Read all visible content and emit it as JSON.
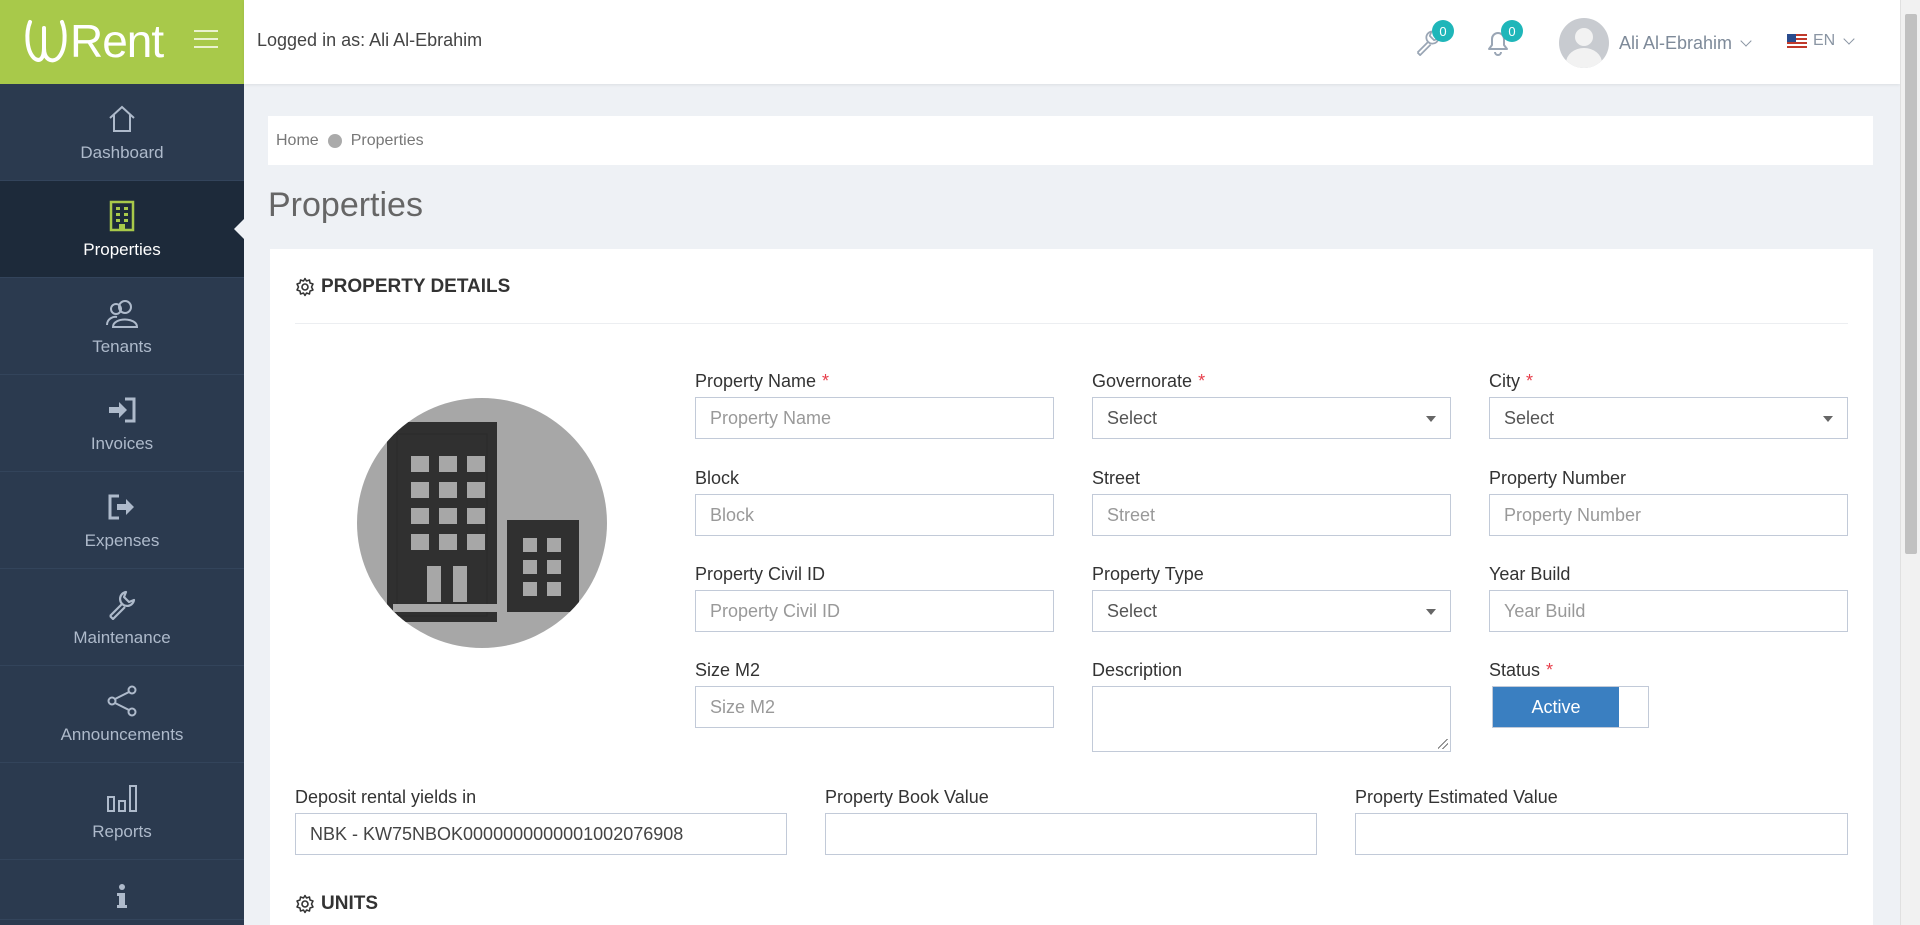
{
  "app": {
    "logo_text": "Rent"
  },
  "sidebar": {
    "items": [
      {
        "label": "Dashboard",
        "icon": "home-icon"
      },
      {
        "label": "Properties",
        "icon": "building-icon"
      },
      {
        "label": "Tenants",
        "icon": "users-icon"
      },
      {
        "label": "Invoices",
        "icon": "sign-in-icon"
      },
      {
        "label": "Expenses",
        "icon": "sign-out-icon"
      },
      {
        "label": "Maintenance",
        "icon": "wrench-icon"
      },
      {
        "label": "Announcements",
        "icon": "share-icon"
      },
      {
        "label": "Reports",
        "icon": "bar-chart-icon"
      },
      {
        "label": "",
        "icon": "info-icon"
      }
    ],
    "active": "Properties"
  },
  "topbar": {
    "logged_in_text": "Logged in as: Ali Al-Ebrahim",
    "maintenance_badge": "0",
    "notifications_badge": "0",
    "user_name": "Ali Al-Ebrahim",
    "language": "EN"
  },
  "breadcrumb": {
    "home": "Home",
    "current": "Properties"
  },
  "page_title": "Properties",
  "property_details": {
    "title": "PROPERTY DETAILS",
    "fields": {
      "property_name": {
        "label": "Property Name",
        "placeholder": "Property Name",
        "required": "*"
      },
      "governorate": {
        "label": "Governorate",
        "value": "Select",
        "required": "*"
      },
      "city": {
        "label": "City",
        "value": "Select",
        "required": "*"
      },
      "block": {
        "label": "Block",
        "placeholder": "Block"
      },
      "street": {
        "label": "Street",
        "placeholder": "Street"
      },
      "property_number": {
        "label": "Property Number",
        "placeholder": "Property Number"
      },
      "civil_id": {
        "label": "Property Civil ID",
        "placeholder": "Property Civil ID"
      },
      "property_type": {
        "label": "Property Type",
        "value": "Select"
      },
      "year_build": {
        "label": "Year Build",
        "placeholder": "Year Build"
      },
      "size": {
        "label": "Size M2",
        "placeholder": "Size M2"
      },
      "description": {
        "label": "Description",
        "value": ""
      },
      "status": {
        "label": "Status",
        "value": "Active",
        "required": "*"
      },
      "deposit": {
        "label": "Deposit rental yields in",
        "value": "NBK - KW75NBOK0000000000001002076908"
      },
      "book_value": {
        "label": "Property Book Value",
        "value": ""
      },
      "estimated_value": {
        "label": "Property Estimated Value",
        "value": ""
      }
    }
  },
  "units": {
    "title": "UNITS"
  },
  "colors": {
    "brand_green": "#a8c94a",
    "sidebar": "#2b3a4f",
    "badge": "#1fb6b9",
    "toggle_active": "#3a7fc1"
  }
}
